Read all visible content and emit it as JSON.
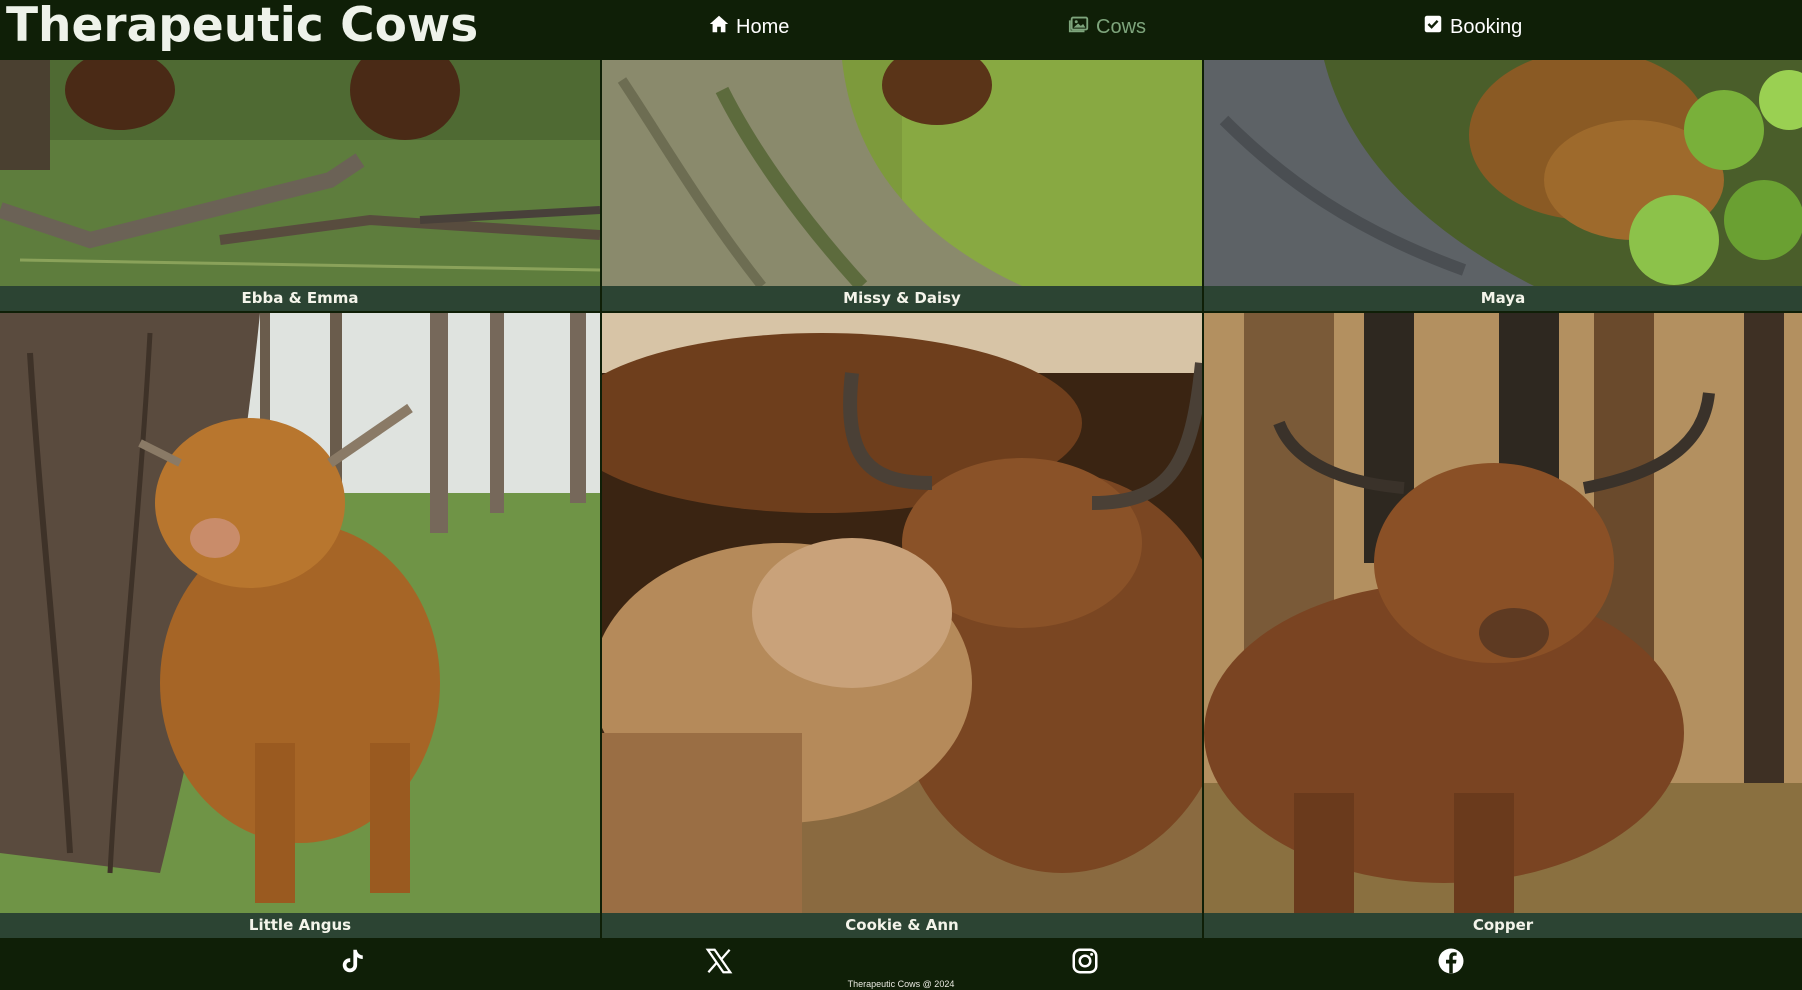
{
  "header": {
    "logo": "Therapeutic Cows",
    "nav": [
      {
        "label": "Home",
        "icon": "home-icon",
        "active": false
      },
      {
        "label": "Cows",
        "icon": "gallery-icon",
        "active": true
      },
      {
        "label": "Booking",
        "icon": "checkbox-icon",
        "active": false
      }
    ]
  },
  "gallery": {
    "items": [
      {
        "caption": "Ebba & Emma",
        "photo": "grass-and-branches-photo"
      },
      {
        "caption": "Missy & Daisy",
        "photo": "tree-trunk-photo"
      },
      {
        "caption": "Maya",
        "photo": "cow-behind-leaves-photo"
      },
      {
        "caption": "Little Angus",
        "photo": "highland-calf-by-tree-photo"
      },
      {
        "caption": "Cookie & Ann",
        "photo": "highland-cow-and-calf-photo"
      },
      {
        "caption": "Copper",
        "photo": "highland-cow-in-forest-photo"
      }
    ]
  },
  "footer": {
    "social": [
      {
        "icon": "tiktok-icon"
      },
      {
        "icon": "x-icon"
      },
      {
        "icon": "instagram-icon"
      },
      {
        "icon": "facebook-icon"
      }
    ],
    "copyright": "Therapeutic Cows @ 2024"
  },
  "colors": {
    "background": "#0f1f07",
    "caption_bar": "#2c4433",
    "active_nav": "#7ea57c",
    "text": "#ffffff"
  }
}
